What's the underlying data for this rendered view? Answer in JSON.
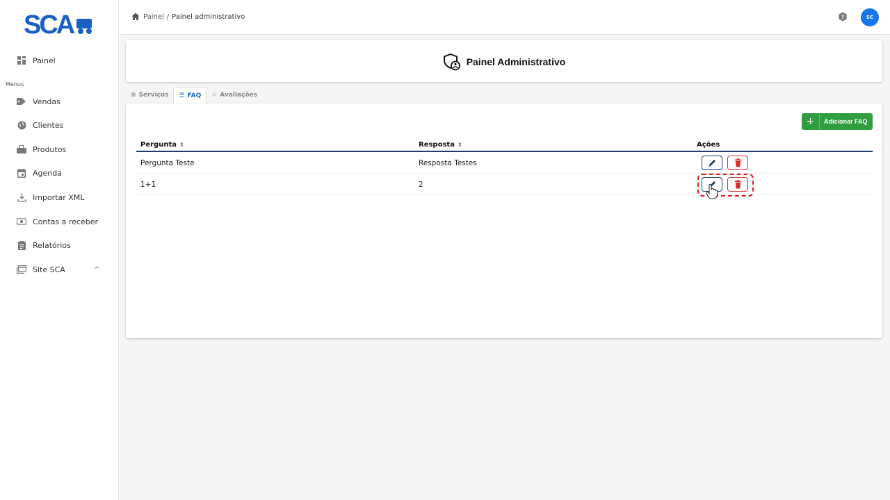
{
  "sidebar": {
    "logo_text": "SCA",
    "menus_label": "Menus",
    "items": [
      {
        "label": "Painel",
        "icon": "dashboard-icon"
      },
      {
        "label": "Vendas",
        "icon": "tag-icon"
      },
      {
        "label": "Clientes",
        "icon": "globe-icon"
      },
      {
        "label": "Produtos",
        "icon": "shopping-bag-icon"
      },
      {
        "label": "Agenda",
        "icon": "calendar-icon"
      },
      {
        "label": "Importar XML",
        "icon": "download-icon"
      },
      {
        "label": "Contas a receber",
        "icon": "money-icon"
      },
      {
        "label": "Relatórios",
        "icon": "report-icon"
      },
      {
        "label": "Site SCA",
        "icon": "browser-icon",
        "chevron": "^"
      }
    ]
  },
  "header": {
    "breadcrumb_root": "Painel",
    "breadcrumb_sep": "/",
    "breadcrumb_current": "Painel administrativo",
    "avatar_initials": "SC"
  },
  "title_card": {
    "title": "Painel Administrativo"
  },
  "tabs": [
    {
      "label": "Serviços",
      "icon": "≡",
      "active": false
    },
    {
      "label": "FAQ",
      "icon": "☰",
      "active": true
    },
    {
      "label": "Avaliações",
      "icon": "☆",
      "active": false
    }
  ],
  "main": {
    "add_button_label": "Adicionar FAQ",
    "add_button_icon": "+",
    "columns": [
      {
        "label": "Pergunta",
        "sort": "⇕"
      },
      {
        "label": "Resposta",
        "sort": "⇕"
      },
      {
        "label": "Ações",
        "sort": ""
      }
    ],
    "rows": [
      {
        "pergunta": "Pergunta Teste",
        "resposta": "Resposta Testes"
      },
      {
        "pergunta": "1+1",
        "resposta": "2"
      }
    ]
  },
  "colors": {
    "brand_blue": "#1976e8",
    "logo_blue": "#1c5fc4",
    "success_green": "#2e9e3f",
    "danger_red": "#d32f2f",
    "navy": "#1e3a6e"
  }
}
